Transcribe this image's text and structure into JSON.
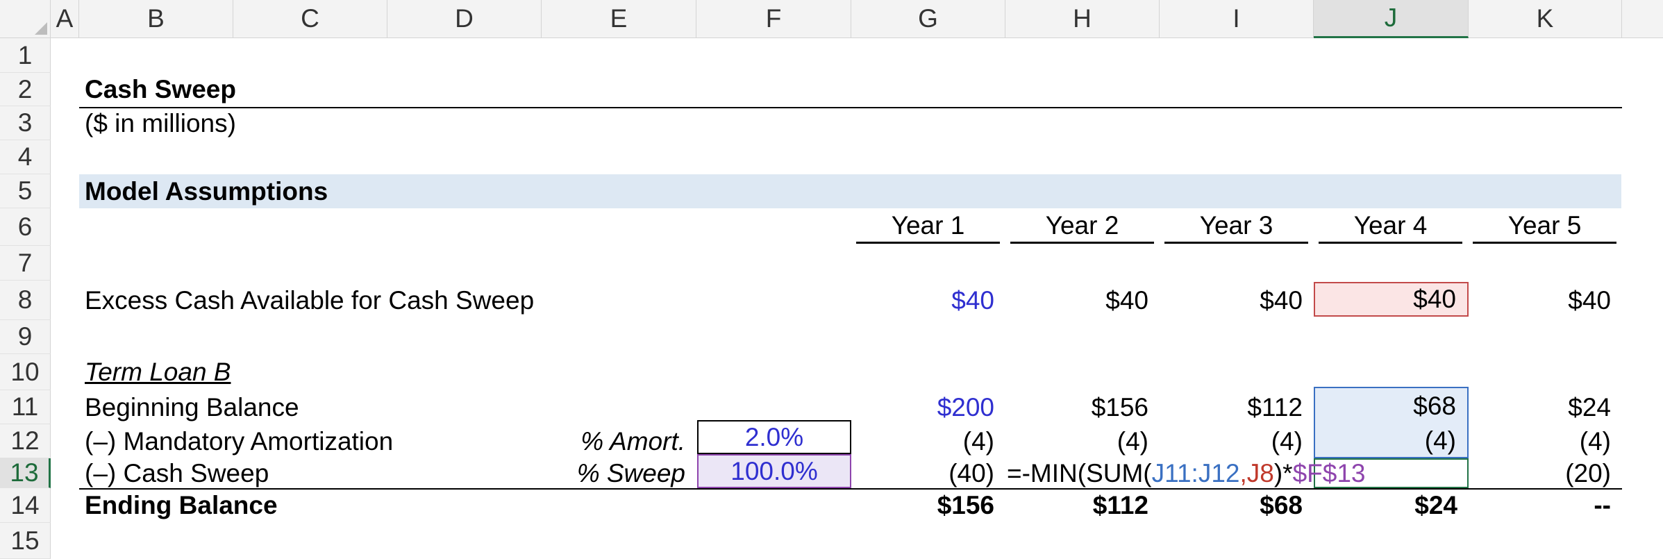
{
  "columns": [
    "A",
    "B",
    "C",
    "D",
    "E",
    "F",
    "G",
    "H",
    "I",
    "J",
    "K"
  ],
  "rows": [
    "1",
    "2",
    "3",
    "4",
    "5",
    "6",
    "7",
    "8",
    "9",
    "10",
    "11",
    "12",
    "13",
    "14",
    "15"
  ],
  "title": "Cash Sweep",
  "subtitle": "($ in millions)",
  "section": "Model Assumptions",
  "years": [
    "Year 1",
    "Year 2",
    "Year 3",
    "Year 4",
    "Year 5"
  ],
  "excess_cash": {
    "label": "Excess Cash Available for Cash Sweep",
    "values": [
      "$40",
      "$40",
      "$40",
      "$40",
      "$40"
    ]
  },
  "term_loan_label": "Term Loan B",
  "beginning_balance": {
    "label": "Beginning Balance",
    "values": [
      "$200",
      "$156",
      "$112",
      "$68",
      "$24"
    ]
  },
  "mandatory_amort": {
    "label": "(–) Mandatory Amortization",
    "input_label": "% Amort.",
    "input_value": "2.0%",
    "values": [
      "(4)",
      "(4)",
      "(4)",
      "(4)",
      "(4)"
    ]
  },
  "cash_sweep": {
    "label": "(–) Cash Sweep",
    "input_label": "% Sweep",
    "input_value": "100.0%",
    "values": [
      "(40)",
      "(20)"
    ]
  },
  "formula": {
    "prefix": "=-MIN(SUM(",
    "ref1": "J11:J12",
    "sep": ",",
    "ref2": "J8",
    "mid": ")*",
    "ref3": "$F$13"
  },
  "ending_balance": {
    "label": "Ending Balance",
    "values": [
      "$156",
      "$112",
      "$68",
      "$24",
      "--"
    ]
  }
}
